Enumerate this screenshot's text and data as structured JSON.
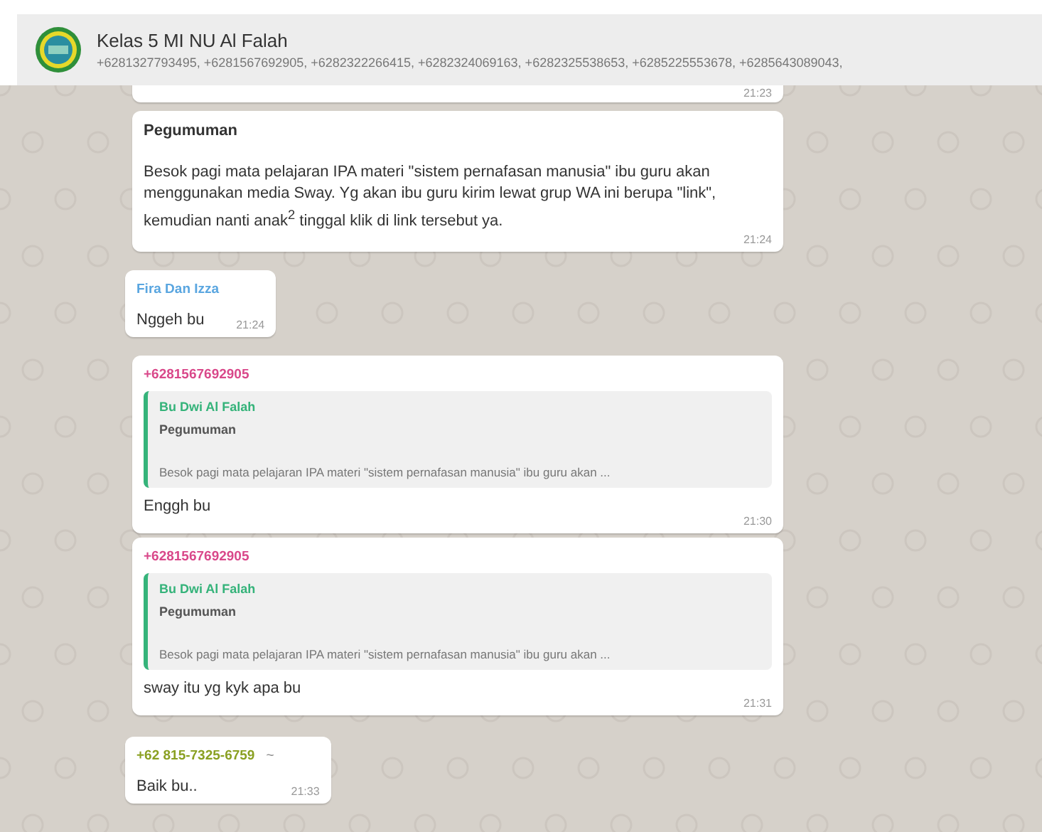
{
  "header": {
    "title": "Kelas 5  MI NU Al Falah",
    "members": "+6281327793495, +6281567692905, +6282322266415, +6282324069163, +6282325538653, +6285225553678, +6285643089043,"
  },
  "messages": [
    {
      "kind": "cut",
      "time": "21:23"
    },
    {
      "kind": "text",
      "title": "Pegumuman",
      "body": "Besok pagi mata pelajaran IPA materi \"sistem pernafasan manusia\" ibu guru akan menggunakan media Sway. Yg akan ibu guru kirim lewat grup WA ini berupa \"link\", kemudian nanti anak$^{2}$ tinggal klik di link tersebut ya.",
      "time": "21:24"
    },
    {
      "kind": "text",
      "sender": "Fira Dan Izza",
      "color": "#5aa6e0",
      "body": "Nggeh bu",
      "time": "21:24"
    },
    {
      "kind": "reply",
      "sender": "+6281567692905",
      "color": "#d9488a",
      "quote": {
        "author": "Bu Dwi Al Falah",
        "title": "Pegumuman",
        "text": "Besok pagi mata pelajaran IPA materi \"sistem pernafasan manusia\" ibu guru akan ..."
      },
      "body": "Enggh bu",
      "time": "21:30"
    },
    {
      "kind": "reply",
      "sender": "+6281567692905",
      "color": "#d9488a",
      "quote": {
        "author": "Bu Dwi Al Falah",
        "title": "Pegumuman",
        "text": "Besok pagi mata pelajaran IPA materi \"sistem pernafasan manusia\" ibu guru akan ..."
      },
      "body": "sway itu yg kyk apa bu",
      "time": "21:31"
    },
    {
      "kind": "text",
      "sender": "+62 815-7325-6759",
      "sender_note": "~",
      "color": "#8aa022",
      "body": "Baik bu..",
      "time": "21:33"
    }
  ]
}
